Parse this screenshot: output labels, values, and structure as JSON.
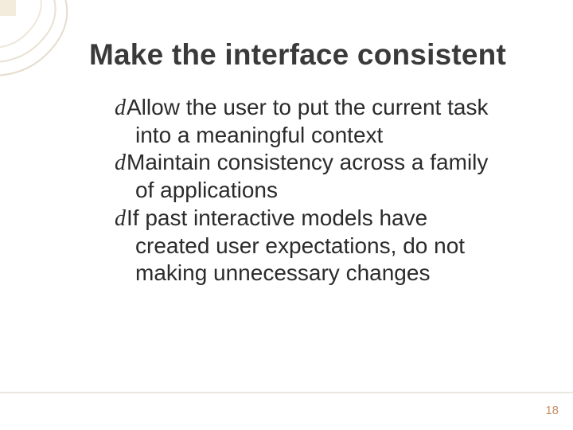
{
  "title": "Make the interface consistent",
  "bullets": [
    {
      "first": "Allow the user to put the current task",
      "rest": [
        "into a meaningful context"
      ]
    },
    {
      "first": "Maintain consistency across a family",
      "rest": [
        "of applications"
      ]
    },
    {
      "first": "If past interactive models have",
      "rest": [
        "created user expectations, do not",
        "making unnecessary changes"
      ]
    }
  ],
  "bullet_glyph": "d",
  "page_number": "18"
}
